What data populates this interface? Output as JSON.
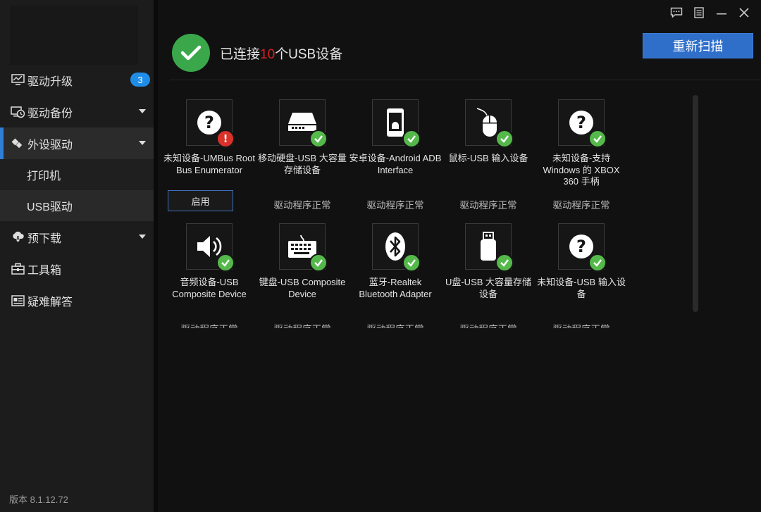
{
  "sidebar": {
    "items": [
      {
        "label": "驱动升级",
        "icon": "monitor-icon",
        "badge": "3"
      },
      {
        "label": "驱动备份",
        "icon": "backup-clock-icon"
      },
      {
        "label": "外设驱动",
        "icon": "peripheral-icon"
      },
      {
        "label": "打印机"
      },
      {
        "label": "USB驱动"
      },
      {
        "label": "预下载",
        "icon": "cloud-download-icon"
      },
      {
        "label": "工具箱",
        "icon": "toolbox-icon"
      },
      {
        "label": "疑难解答",
        "icon": "help-card-icon"
      }
    ],
    "version": "版本 8.1.12.72"
  },
  "header": {
    "status_prefix": "已连接",
    "status_count": "10",
    "status_suffix": "个USB设备",
    "rescan_label": "重新扫描"
  },
  "window_controls": [
    "feedback-icon",
    "menu-icon",
    "minimize-icon",
    "close-icon"
  ],
  "devices": [
    {
      "name": "未知设备-UMBus Root Bus Enumerator",
      "icon": "question-icon",
      "status": "error",
      "action": "启用"
    },
    {
      "name": "移动硬盘-USB 大容量存储设备",
      "icon": "hard-drive-icon",
      "status": "ok",
      "state": "驱动程序正常"
    },
    {
      "name": "安卓设备-Android ADB Interface",
      "icon": "android-phone-icon",
      "status": "ok",
      "state": "驱动程序正常"
    },
    {
      "name": "鼠标-USB 输入设备",
      "icon": "mouse-icon",
      "status": "ok",
      "state": "驱动程序正常"
    },
    {
      "name": "未知设备-支持Windows 的 XBOX 360 手柄",
      "icon": "question-icon",
      "status": "ok",
      "state": "驱动程序正常"
    },
    {
      "name": "音频设备-USB Composite Device",
      "icon": "speaker-icon",
      "status": "ok",
      "state": "驱动程序正常"
    },
    {
      "name": "键盘-USB Composite Device",
      "icon": "keyboard-icon",
      "status": "ok",
      "state": "驱动程序正常"
    },
    {
      "name": "蓝牙-Realtek Bluetooth Adapter",
      "icon": "bluetooth-icon",
      "status": "ok",
      "state": "驱动程序正常"
    },
    {
      "name": "U盘-USB 大容量存储设备",
      "icon": "usb-drive-icon",
      "status": "ok",
      "state": "驱动程序正常"
    },
    {
      "name": "未知设备-USB 输入设备",
      "icon": "question-icon",
      "status": "ok",
      "state": "驱动程序正常"
    }
  ],
  "colors": {
    "accent": "#2f6fca",
    "ok": "#54b94a",
    "error": "#d9322b",
    "highlight": "#e02020"
  }
}
